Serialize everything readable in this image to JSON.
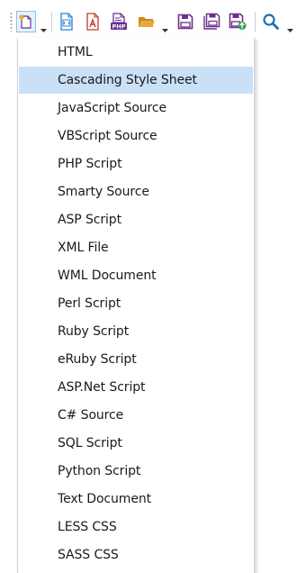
{
  "toolbar": {
    "buttons": [
      {
        "icon": "new-file-icon",
        "has_dropdown": true,
        "pressed": true
      },
      {
        "icon": "html-file-icon"
      },
      {
        "icon": "pdf-file-icon"
      },
      {
        "icon": "php-file-icon"
      },
      {
        "icon": "open-folder-icon",
        "has_dropdown": true
      },
      {
        "icon": "save-icon"
      },
      {
        "icon": "save-all-icon"
      },
      {
        "icon": "save-upload-icon"
      },
      {
        "icon": "search-icon",
        "has_dropdown": true
      }
    ],
    "icon_colors": {
      "purple": "#6b2f8f",
      "blue": "#2a7fd4",
      "red": "#c0392b",
      "folder": "#e8a93a",
      "green": "#2e9e4f",
      "search": "#1f6fb8"
    }
  },
  "menu": {
    "highlight_color": "#c9e0f7",
    "hovered_index": 1,
    "items": [
      {
        "label": "HTML"
      },
      {
        "label": "Cascading Style Sheet"
      },
      {
        "label": "JavaScript Source"
      },
      {
        "label": "VBScript Source"
      },
      {
        "label": "PHP Script"
      },
      {
        "label": "Smarty Source"
      },
      {
        "label": "ASP Script"
      },
      {
        "label": "XML File"
      },
      {
        "label": "WML Document"
      },
      {
        "label": "Perl Script"
      },
      {
        "label": "Ruby Script"
      },
      {
        "label": "eRuby Script"
      },
      {
        "label": "ASP.Net Script"
      },
      {
        "label": "C# Source"
      },
      {
        "label": "SQL Script"
      },
      {
        "label": "Python Script"
      },
      {
        "label": "Text Document"
      },
      {
        "label": "LESS CSS"
      },
      {
        "label": "SASS CSS"
      }
    ]
  }
}
